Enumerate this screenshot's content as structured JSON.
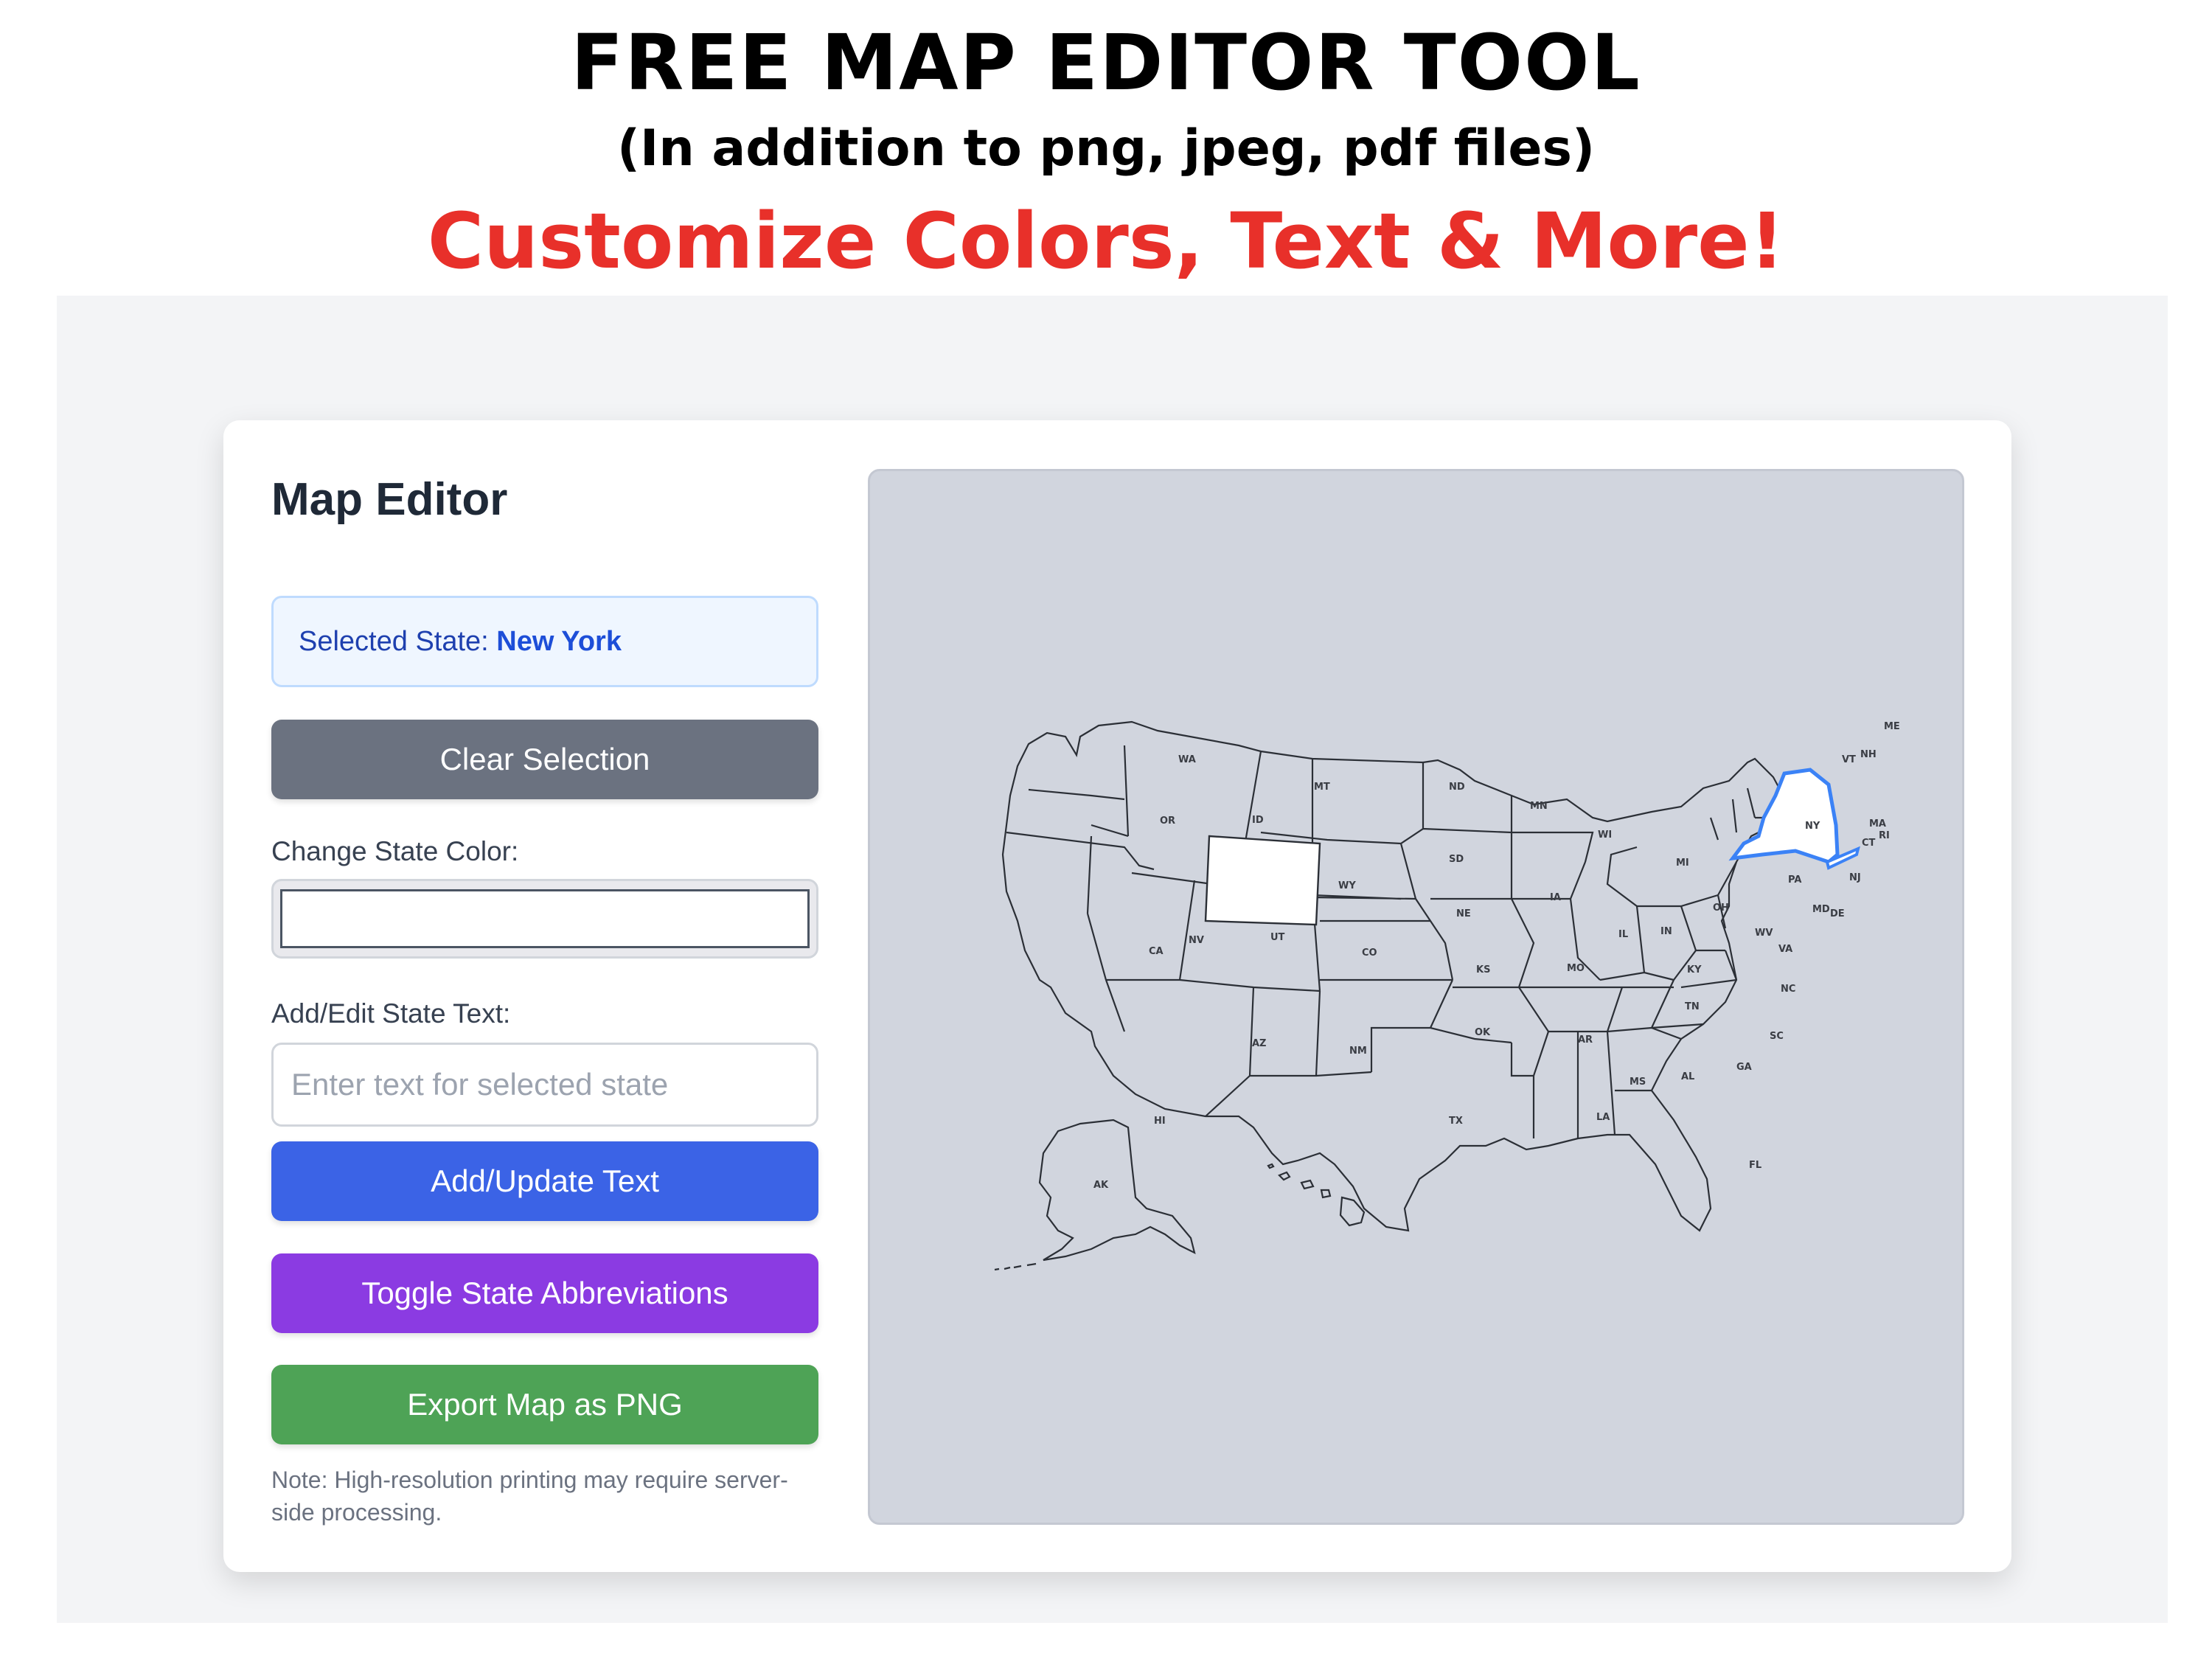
{
  "banner": {
    "title": "FREE MAP EDITOR TOOL",
    "subtitle": "(In addition to png, jpeg, pdf files)",
    "tagline": "Customize Colors, Text & More!"
  },
  "editor": {
    "title": "Map Editor",
    "selected_label": "Selected State:",
    "selected_value": "New York",
    "clear_button": "Clear Selection",
    "color_label": "Change State Color:",
    "color_value": "#ffffff",
    "text_label": "Add/Edit State Text:",
    "text_placeholder": "Enter text for selected state",
    "text_value": "",
    "add_text_button": "Add/Update Text",
    "toggle_button": "Toggle State Abbreviations",
    "export_button": "Export Map as PNG",
    "note": "Note: High-resolution printing may require server-side processing."
  },
  "map": {
    "selected_state": "NY",
    "colors": {
      "background": "#d1d5de",
      "selected_fill": "#ffffff",
      "selected_outline": "#3b82f6",
      "highlighted_fill": "#ffffff"
    },
    "highlighted_states": [
      "WY",
      "NY"
    ],
    "abbreviations": [
      "WA",
      "OR",
      "CA",
      "ID",
      "NV",
      "MT",
      "WY",
      "UT",
      "AZ",
      "CO",
      "NM",
      "ND",
      "SD",
      "NE",
      "KS",
      "OK",
      "TX",
      "MN",
      "IA",
      "MO",
      "AR",
      "LA",
      "WI",
      "IL",
      "MI",
      "IN",
      "OH",
      "KY",
      "TN",
      "MS",
      "AL",
      "GA",
      "FL",
      "SC",
      "NC",
      "VA",
      "WV",
      "PA",
      "NY",
      "VT",
      "NH",
      "ME",
      "MA",
      "CT",
      "NJ",
      "MD",
      "DE",
      "RI",
      "HI",
      "AK"
    ]
  }
}
